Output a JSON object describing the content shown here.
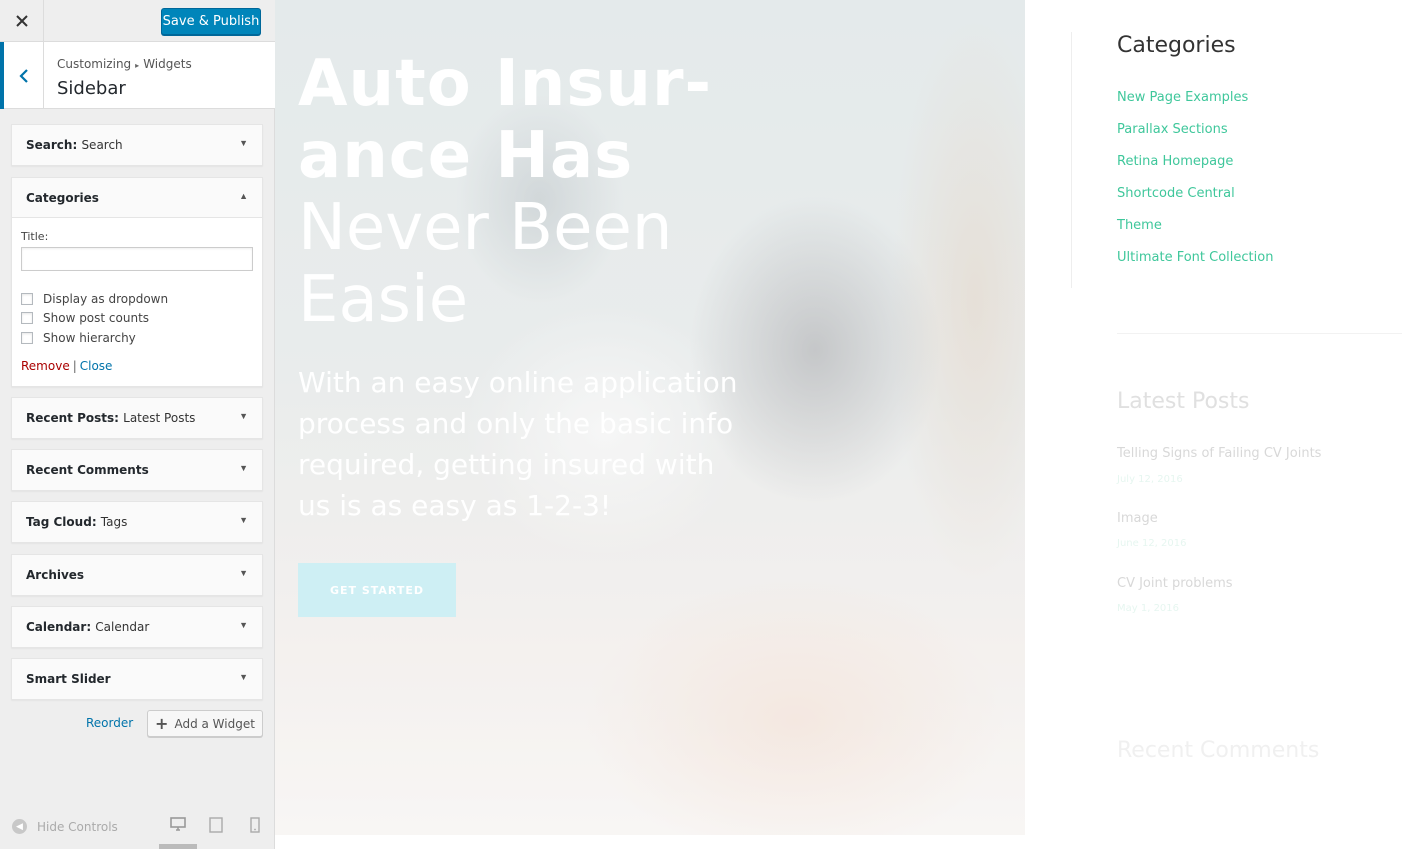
{
  "topbar": {
    "close_icon": "close-icon",
    "publish_label": "Save & Publish"
  },
  "section": {
    "breadcrumb_root": "Customizing",
    "breadcrumb_child": "Widgets",
    "title": "Sidebar"
  },
  "widgets": [
    {
      "name": "Search",
      "sub": "Search",
      "state": "collapsed"
    },
    {
      "name": "Categories",
      "sub": "",
      "state": "expanded"
    },
    {
      "name": "Recent Posts",
      "sub": "Latest Posts",
      "state": "collapsed"
    },
    {
      "name": "Recent Comments",
      "sub": "",
      "state": "collapsed"
    },
    {
      "name": "Tag Cloud",
      "sub": "Tags",
      "state": "collapsed"
    },
    {
      "name": "Archives",
      "sub": "",
      "state": "collapsed"
    },
    {
      "name": "Calendar",
      "sub": "Calendar",
      "state": "collapsed"
    },
    {
      "name": "Smart Slider",
      "sub": "",
      "state": "collapsed"
    }
  ],
  "categories_form": {
    "title_label": "Title:",
    "title_value": "",
    "options": [
      "Display as dropdown",
      "Show post counts",
      "Show hierarchy"
    ],
    "remove_label": "Remove",
    "separator": "|",
    "close_label": "Close"
  },
  "actions": {
    "reorder_label": "Reorder",
    "add_widget_label": "Add a Widget"
  },
  "footer": {
    "hide_controls_label": "Hide Controls",
    "active_device": "desktop"
  },
  "hero": {
    "bold_line1": "Auto Insur-",
    "bold_line2": "ance Has",
    "light_line1": "Never Been",
    "light_line2": "Easie",
    "subtitle": "With an easy online application process and only the basic info required, getting insured with us is as easy as 1-2-3!",
    "cta": "GET STARTED"
  },
  "sidebar_preview": {
    "categories_title": "Categories",
    "categories": [
      "New Page Examples",
      "Parallax Sections",
      "Retina Homepage",
      "Shortcode Central",
      "Theme",
      "Ultimate Font Collection"
    ],
    "latest_posts_title": "Latest Posts",
    "posts": [
      {
        "title": "Telling Signs of Failing CV Joints",
        "date": "July 12, 2016"
      },
      {
        "title": "Image",
        "date": "June 12, 2016"
      },
      {
        "title": "CV Joint problems",
        "date": "May 1, 2016"
      }
    ],
    "recent_comments_title": "Recent Comments"
  },
  "colors": {
    "accent": "#0085ba",
    "link": "#0073aa",
    "remove": "#aa0000",
    "category_link": "#3fc79b"
  }
}
